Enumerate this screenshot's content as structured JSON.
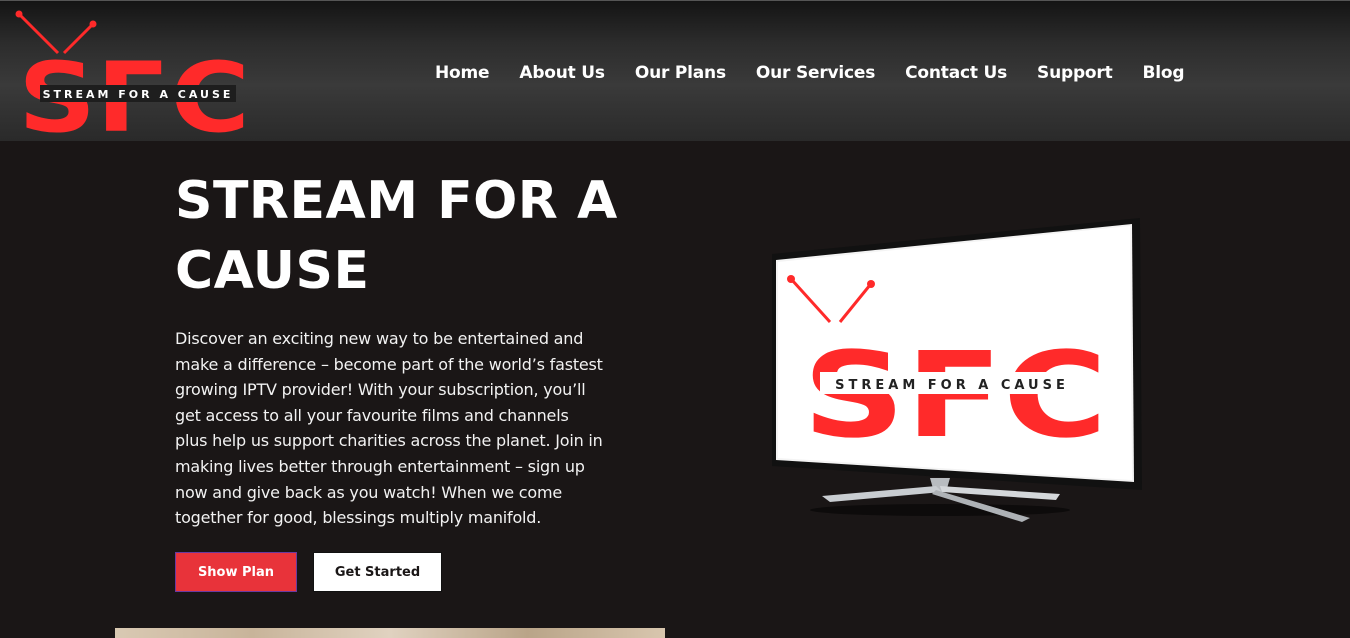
{
  "brand": {
    "logo_letters": "SFC",
    "logo_tagline": "STREAM FOR A CAUSE",
    "accent_color": "#ff2a2a"
  },
  "nav": {
    "items": [
      {
        "label": "Home"
      },
      {
        "label": "About Us"
      },
      {
        "label": "Our Plans"
      },
      {
        "label": "Our Services"
      },
      {
        "label": "Contact Us"
      },
      {
        "label": "Support"
      },
      {
        "label": "Blog"
      }
    ]
  },
  "hero": {
    "title": "STREAM FOR A CAUSE",
    "description": "Discover an exciting new way to be entertained and make a difference – become part of the world’s fastest growing IPTV provider! With your subscription, you’ll get access to all your favourite films and channels plus help us support charities across the planet. Join in making lives better through entertainment – sign up now and give back as you watch! When we come together for good, blessings multiply manifold.",
    "primary_button": "Show Plan",
    "secondary_button": "Get Started"
  },
  "colors": {
    "background": "#1a1616",
    "primary_button": "#e8333a"
  }
}
